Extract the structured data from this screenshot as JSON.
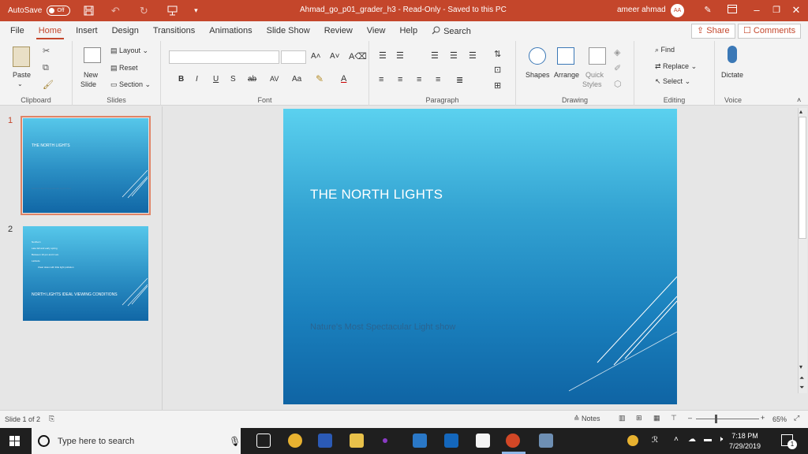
{
  "titlebar": {
    "autosave_label": "AutoSave",
    "autosave_state": "Off",
    "doc_title": "Ahmad_go_p01_grader_h3  -  Read-Only  -  Saved to this PC",
    "user_name": "ameer ahmad",
    "user_initials": "AA"
  },
  "tabs": [
    "File",
    "Home",
    "Insert",
    "Design",
    "Transitions",
    "Animations",
    "Slide Show",
    "Review",
    "View",
    "Help"
  ],
  "active_tab": "Home",
  "search_label": "Search",
  "share_label": "Share",
  "comments_label": "Comments",
  "ribbon": {
    "clipboard": {
      "label": "Clipboard",
      "paste": "Paste"
    },
    "slides": {
      "label": "Slides",
      "new_slide_1": "New",
      "new_slide_2": "Slide",
      "layout": "Layout",
      "reset": "Reset",
      "section": "Section"
    },
    "font": {
      "label": "Font"
    },
    "paragraph": {
      "label": "Paragraph"
    },
    "drawing": {
      "label": "Drawing",
      "shapes": "Shapes",
      "arrange": "Arrange",
      "quick_styles_1": "Quick",
      "quick_styles_2": "Styles"
    },
    "editing": {
      "label": "Editing",
      "find": "Find",
      "replace": "Replace",
      "select": "Select"
    },
    "voice": {
      "label": "Voice",
      "dictate": "Dictate"
    }
  },
  "thumbnails": [
    {
      "number": "1",
      "title": "THE NORTH LIGHTS",
      "subtitle": "Nature's Most Spectacular Light show"
    },
    {
      "number": "2",
      "title": "NORTH LIGHTS IDEAL VIEWING CONDITIONS",
      "bullets": [
        "Northern",
        "Late fall and early spring",
        "Between 10 pm and 2 am",
        "Latitude",
        "Clear skies with little light pollution"
      ]
    }
  ],
  "slide": {
    "title": "THE NORTH LIGHTS",
    "subtitle": "Nature's Most Spectacular Light show"
  },
  "statusbar": {
    "slide_info": "Slide 1 of 2",
    "notes": "Notes",
    "zoom": "65%"
  },
  "taskbar": {
    "search_placeholder": "Type here to search",
    "time": "7:18 PM",
    "date": "7/29/2019",
    "notification_count": "1"
  }
}
